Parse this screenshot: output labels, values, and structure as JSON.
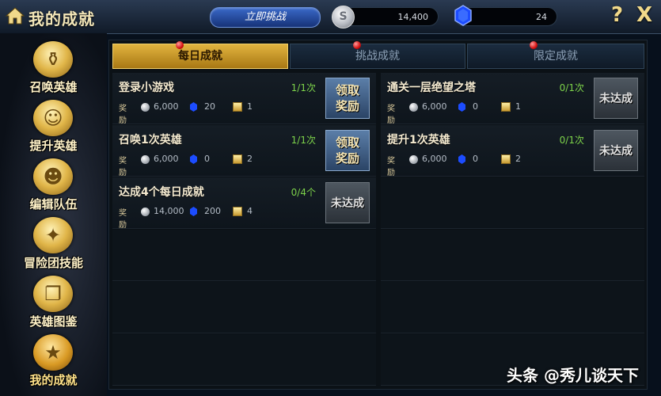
{
  "header": {
    "title": "我的成就",
    "challenge_button": "立即挑战",
    "silver_amount": "14,400",
    "gem_amount": "24",
    "help_label": "?",
    "close_label": "X"
  },
  "sidebar": {
    "items": [
      {
        "label": "召唤英雄",
        "icon": "summon-jar-icon",
        "active": false
      },
      {
        "label": "提升英雄",
        "icon": "level-up-icon",
        "active": false
      },
      {
        "label": "编辑队伍",
        "icon": "team-icon",
        "active": false
      },
      {
        "label": "冒险团技能",
        "icon": "shuriken-icon",
        "active": false
      },
      {
        "label": "英雄图鉴",
        "icon": "book-icon",
        "active": false
      },
      {
        "label": "我的成就",
        "icon": "medal-icon",
        "active": true
      }
    ]
  },
  "tabs": [
    {
      "label": "每日成就",
      "active": true
    },
    {
      "label": "挑战成就",
      "active": false
    },
    {
      "label": "限定成就",
      "active": false
    }
  ],
  "reward_label": "奖励",
  "achievements_left": [
    {
      "title": "登录小游戏",
      "progress": "1/1次",
      "silver": "6,000",
      "gems": "20",
      "scrolls": "1",
      "button": "领取\n奖励",
      "claimable": true
    },
    {
      "title": "召唤1次英雄",
      "progress": "1/1次",
      "silver": "6,000",
      "gems": "0",
      "scrolls": "2",
      "button": "领取\n奖励",
      "claimable": true
    },
    {
      "title": "达成4个每日成就",
      "progress": "0/4个",
      "silver": "14,000",
      "gems": "200",
      "scrolls": "4",
      "button": "未达成",
      "claimable": false
    }
  ],
  "achievements_right": [
    {
      "title": "通关一层绝望之塔",
      "progress": "0/1次",
      "silver": "6,000",
      "gems": "0",
      "scrolls": "1",
      "button": "未达成",
      "claimable": false
    },
    {
      "title": "提升1次英雄",
      "progress": "0/1次",
      "silver": "6,000",
      "gems": "0",
      "scrolls": "2",
      "button": "未达成",
      "claimable": false
    }
  ],
  "watermark": "头条 @秀儿谈天下",
  "colors": {
    "active_tab": "#e2b43f",
    "progress_green": "#7cd24a",
    "notification_red": "#d41010",
    "gem_blue": "#1c4cff"
  }
}
